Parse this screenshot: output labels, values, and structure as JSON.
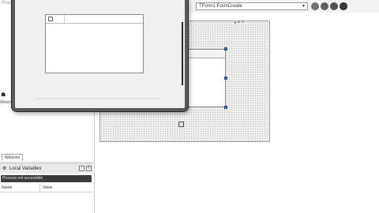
{
  "left_panel": {
    "title_text": "Proce",
    "watches_fragment": "Watch",
    "icons_glyph": "☗",
    "watches_tab": "Watches",
    "locals": {
      "icon_glyph": "⚙",
      "title": "Local Variables",
      "button1_glyph": "↓",
      "button2_glyph": "≡",
      "combo_text": "Process not accessible",
      "columns": [
        "Name",
        "Value"
      ]
    }
  },
  "toolbar": {
    "event_selector_value": "TForm1.FormCreate",
    "combo_arrow_glyph": "▾"
  },
  "designer": {
    "caption_glyphs": "◒◓◔"
  },
  "colors": {
    "designer_background": "#efefef",
    "selection_handle": "#2f7fd1",
    "window_frame": "#5a5a5a"
  }
}
